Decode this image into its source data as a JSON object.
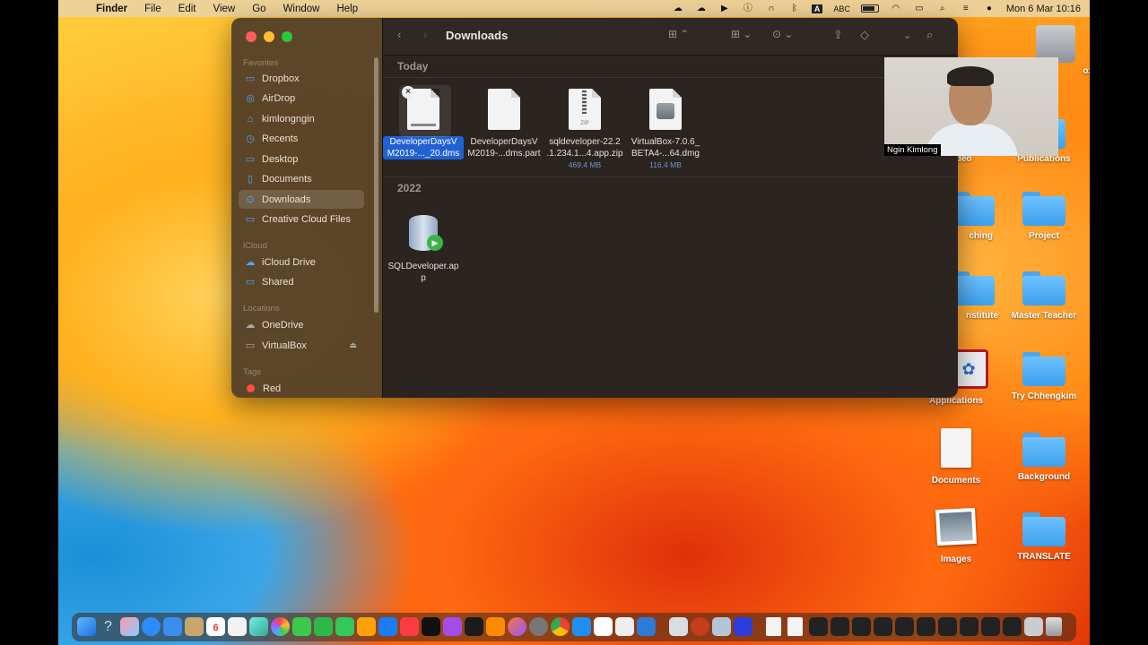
{
  "menubar": {
    "app": "Finder",
    "items": [
      "File",
      "Edit",
      "View",
      "Go",
      "Window",
      "Help"
    ],
    "input_source": "ABC",
    "clock": "Mon 6 Mar  10:16"
  },
  "sidebar": {
    "sections": {
      "favorites": "Favorites",
      "icloud": "iCloud",
      "locations": "Locations",
      "tags": "Tags"
    },
    "favorites": [
      "Dropbox",
      "AirDrop",
      "kimlongngin",
      "Recents",
      "Desktop",
      "Documents",
      "Downloads",
      "Creative Cloud Files"
    ],
    "icloud": [
      "iCloud Drive",
      "Shared"
    ],
    "locations": [
      "OneDrive",
      "VirtualBox"
    ],
    "tags": [
      "Red"
    ]
  },
  "window": {
    "title": "Downloads"
  },
  "groups": [
    {
      "title": "Today",
      "files": [
        {
          "name_line1": "DeveloperDaysV",
          "name_line2": "M2019-..._20.dms",
          "size": "",
          "icon": "document-icon",
          "selected": true
        },
        {
          "name_line1": "DeveloperDaysV",
          "name_line2": "M2019-...dms.part",
          "size": "",
          "icon": "document-icon",
          "selected": false
        },
        {
          "name_line1": "sqldeveloper-22.2",
          "name_line2": ".1.234.1...4.app.zip",
          "size": "469,4 MB",
          "icon": "zip-icon",
          "selected": false
        },
        {
          "name_line1": "VirtualBox-7.0.6_",
          "name_line2": "BETA4-...64.dmg",
          "size": "116,4 MB",
          "icon": "disk-image-icon",
          "selected": false
        }
      ]
    },
    {
      "title": "2022",
      "files": [
        {
          "name_line1": "SQLDeveloper.ap",
          "name_line2": "p",
          "size": "",
          "icon": "database-app-icon",
          "selected": false
        }
      ]
    }
  ],
  "webcam": {
    "label": "Ngin Kimlong"
  },
  "desktop": {
    "icons": [
      {
        "label": "Video",
        "kind": "folder"
      },
      {
        "label": "Publications",
        "kind": "folder"
      },
      {
        "label": "ching",
        "kind": "folder"
      },
      {
        "label": "Project",
        "kind": "folder"
      },
      {
        "label": "nstitute",
        "kind": "folder"
      },
      {
        "label": "Master Teacher",
        "kind": "folder"
      },
      {
        "label": "Applications",
        "kind": "app"
      },
      {
        "label": "Try Chhengkim",
        "kind": "folder"
      },
      {
        "label": "Documents",
        "kind": "document"
      },
      {
        "label": "Background",
        "kind": "folder"
      },
      {
        "label": "Images",
        "kind": "image"
      },
      {
        "label": "TRANSLATE",
        "kind": "folder"
      },
      {
        "label": "ox",
        "kind": "disk"
      }
    ]
  },
  "dock": {
    "calendar_day": "6"
  },
  "colors": {
    "accent": "#2161d1",
    "folder_blue": "#3d9fec",
    "sidebar_icon": "#4ea6ff",
    "tag_red": "#ff4b45"
  }
}
